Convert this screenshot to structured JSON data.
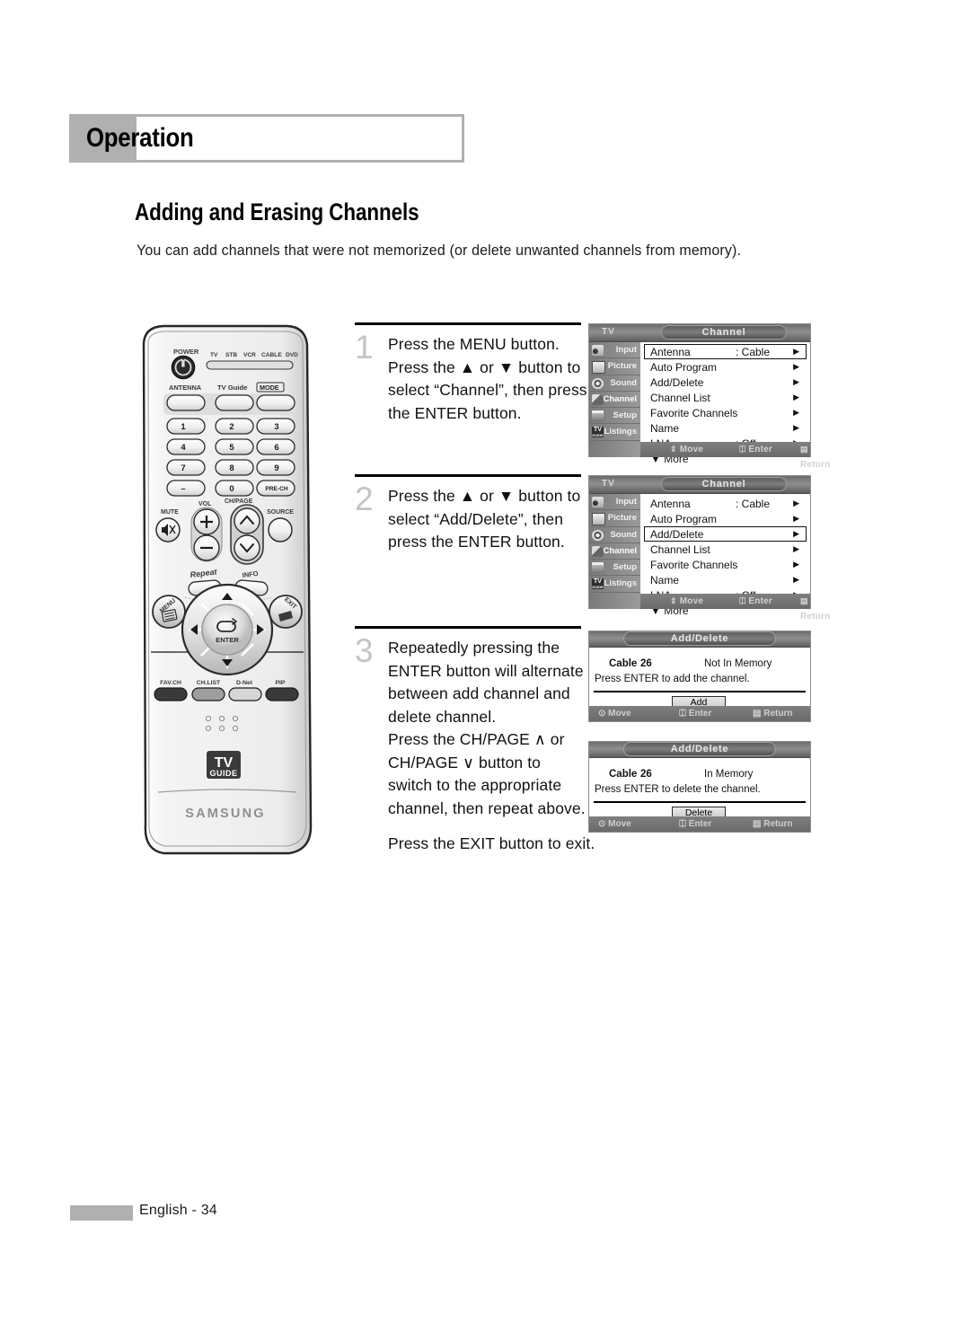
{
  "header": {
    "chapter": "Operation",
    "section_title": "Adding and Erasing Channels",
    "intro": "You can add channels that were not memorized (or delete unwanted channels from memory)."
  },
  "steps": [
    {
      "number": "1",
      "lines": [
        "Press the MENU button.",
        "Press the ▲ or ▼ button to",
        "select “Channel”, then press",
        "the ENTER button."
      ]
    },
    {
      "number": "2",
      "lines": [
        "Press the ▲ or ▼ button to",
        "select “Add/Delete”, then",
        "press the ENTER button."
      ]
    },
    {
      "number": "3",
      "lines": [
        "Repeatedly pressing the",
        "ENTER button will alternate",
        "between add channel and",
        "delete channel.",
        "Press the CH/PAGE ∧ or",
        "CH/PAGE ∨ button to",
        "switch to the appropriate",
        "channel, then repeat above."
      ],
      "closing": "Press the EXIT button to exit."
    }
  ],
  "osd": {
    "device_label": "TV",
    "title": "Channel",
    "sidebar": [
      {
        "label": "Input",
        "icon": "input-icon"
      },
      {
        "label": "Picture",
        "icon": "picture-icon"
      },
      {
        "label": "Sound",
        "icon": "sound-icon"
      },
      {
        "label": "Channel",
        "icon": "channel-icon"
      },
      {
        "label": "Setup",
        "icon": "setup-icon"
      },
      {
        "label": "Listings",
        "icon": "tvguide-listings-icon"
      }
    ],
    "selected_sidebar": "Channel",
    "rows": [
      {
        "label": "Antenna",
        "value": ": Cable"
      },
      {
        "label": "Auto Program",
        "value": ""
      },
      {
        "label": "Add/Delete",
        "value": ""
      },
      {
        "label": "Channel List",
        "value": ""
      },
      {
        "label": "Favorite Channels",
        "value": ""
      },
      {
        "label": "Name",
        "value": ""
      },
      {
        "label": "LNA",
        "value": ": Off"
      }
    ],
    "more_label": "▼ More",
    "highlight_step1": "Antenna",
    "highlight_step2": "Add/Delete",
    "footer": {
      "move": "Move",
      "enter": "Enter",
      "return": "Return"
    }
  },
  "dialogs": [
    {
      "title": "Add/Delete",
      "channel_source": "Cable",
      "channel_number": "26",
      "status": "Not In Memory",
      "instruction": "Press ENTER to add the channel.",
      "button": "Add",
      "footer": {
        "move": "Move",
        "enter": "Enter",
        "return": "Return"
      }
    },
    {
      "title": "Add/Delete",
      "channel_source": "Cable",
      "channel_number": "26",
      "status": "In Memory",
      "instruction": "Press ENTER to delete the channel.",
      "button": "Delete",
      "footer": {
        "move": "Move",
        "enter": "Enter",
        "return": "Return"
      }
    }
  ],
  "remote": {
    "power_label": "POWER",
    "mode_strip": [
      "TV",
      "STB",
      "VCR",
      "CABLE",
      "DVD"
    ],
    "row_top": [
      "ANTENNA",
      "TV Guide",
      "MODE"
    ],
    "keypad": [
      "1",
      "2",
      "3",
      "4",
      "5",
      "6",
      "7",
      "8",
      "9",
      "–",
      "0",
      "PRE-CH"
    ],
    "vol_label": "VOL",
    "chpage_label": "CH/PAGE",
    "mute_label": "MUTE",
    "source_label": "SOURCE",
    "repeat_label": "Repeat",
    "info_label": "INFO",
    "menu_label": "MENU",
    "exit_label": "EXIT",
    "enter_label": "ENTER",
    "bottom_row": [
      "FAV.CH",
      "CH.LIST",
      "D-Net",
      "PIP"
    ],
    "tvguide_logo_top": "TV",
    "tvguide_logo_bottom": "GUIDE",
    "brand": "SAMSUNG"
  },
  "footer": {
    "page": "English - 34"
  },
  "colors": {
    "header_gray": "#b0b0b0",
    "step_number_gray": "#c4c4c4",
    "osd_bar": "#7f7f7f",
    "text": "#111111"
  }
}
